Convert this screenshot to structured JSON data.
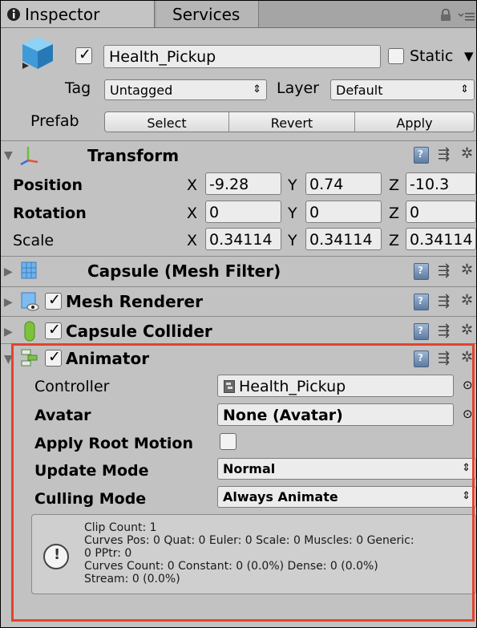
{
  "tabs": {
    "inspector": "Inspector",
    "services": "Services",
    "inspector_icon": "info-circle-icon",
    "lock_icon": "lock-icon",
    "menu_icon": "menu-icon"
  },
  "object": {
    "name": "Health_Pickup",
    "active": true,
    "static_label": "Static",
    "static_checked": false,
    "tag_label": "Tag",
    "tag_value": "Untagged",
    "layer_label": "Layer",
    "layer_value": "Default",
    "prefab_label": "Prefab",
    "prefab_buttons": [
      "Select",
      "Revert",
      "Apply"
    ]
  },
  "transform": {
    "title": "Transform",
    "rows": [
      {
        "label": "Position",
        "x": "-9.28",
        "y": "0.74",
        "z": "-10.3"
      },
      {
        "label": "Rotation",
        "x": "0",
        "y": "0",
        "z": "0"
      },
      {
        "label": "Scale",
        "x": "0.34114",
        "y": "0.34114",
        "z": "0.34114"
      }
    ],
    "axis": [
      "X",
      "Y",
      "Z"
    ]
  },
  "components": [
    {
      "title": "Capsule (Mesh Filter)",
      "has_checkbox": false
    },
    {
      "title": "Mesh Renderer",
      "has_checkbox": true
    },
    {
      "title": "Capsule Collider",
      "has_checkbox": true
    }
  ],
  "animator": {
    "title": "Animator",
    "enabled": true,
    "controller_label": "Controller",
    "controller_value": "Health_Pickup",
    "avatar_label": "Avatar",
    "avatar_value": "None (Avatar)",
    "root_motion_label": "Apply Root Motion",
    "root_motion_checked": false,
    "update_mode_label": "Update Mode",
    "update_mode_value": "Normal",
    "culling_mode_label": "Culling Mode",
    "culling_mode_value": "Always Animate",
    "info_lines": [
      "Clip Count: 1",
      "Curves Pos: 0 Quat: 0 Euler: 0 Scale: 0 Muscles: 0 Generic:",
      "0 PPtr: 0",
      "Curves Count: 0 Constant: 0 (0.0%) Dense: 0 (0.0%)",
      "Stream: 0 (0.0%)"
    ]
  },
  "colors": {
    "panel_bg": "#c2c2c2",
    "highlight_border": "#e4432b"
  }
}
